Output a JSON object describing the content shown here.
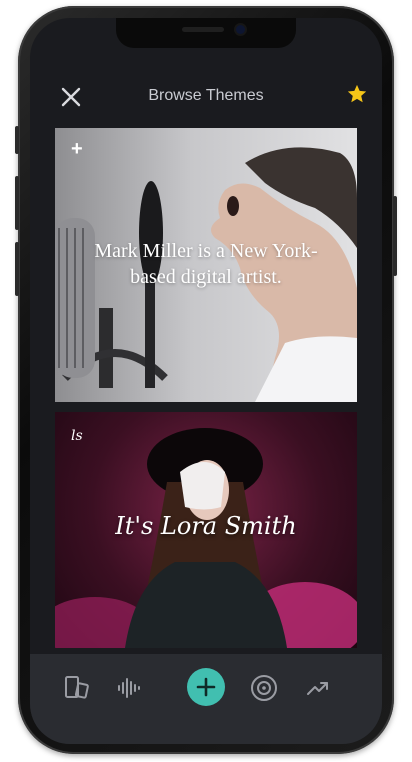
{
  "header": {
    "title": "Browse Themes",
    "close_icon": "close-icon",
    "favorite_icon": "star-icon"
  },
  "cards": [
    {
      "corner_label": "+",
      "text": "Mark Miller is a New York-based digital artist."
    },
    {
      "corner_label": "ls",
      "text": "It's Lora Smith"
    }
  ],
  "tabbar": {
    "items": [
      "devices-icon",
      "waveform-icon",
      "add-icon",
      "vinyl-icon",
      "trending-icon"
    ]
  },
  "colors": {
    "screen_bg": "#1a1b1f",
    "tabbar_bg": "#2a2c31",
    "accent": "#41bfb0",
    "star": "#f5c518",
    "title_text": "#c9cbd1"
  }
}
